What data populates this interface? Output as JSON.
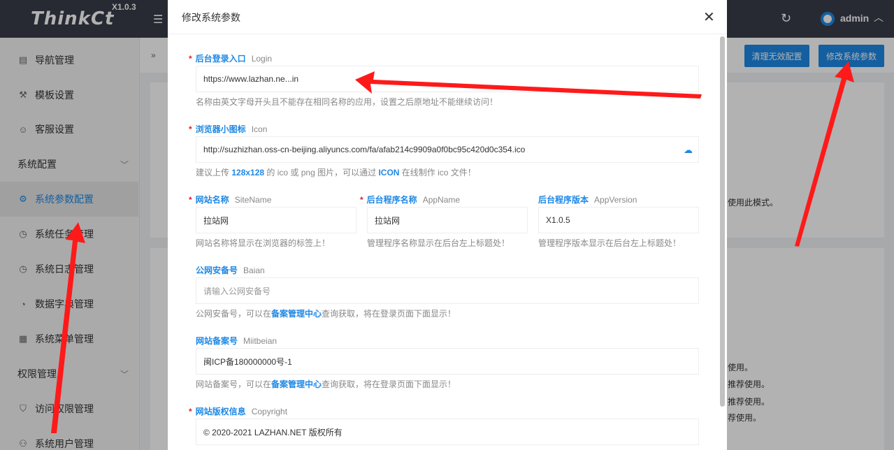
{
  "header": {
    "logo": "ThinkCt",
    "version": "X1.0.3",
    "user": "admin"
  },
  "sidebar": {
    "items": [
      {
        "label": "导航管理",
        "icon": "file-icon"
      },
      {
        "label": "模板设置",
        "icon": "hammer-icon"
      },
      {
        "label": "客服设置",
        "icon": "smile-icon"
      },
      {
        "label": "系统配置",
        "group": true
      },
      {
        "label": "系统参数配置",
        "icon": "gear-icon",
        "active": true
      },
      {
        "label": "系统任务管理",
        "icon": "clock-icon"
      },
      {
        "label": "系统日志管理",
        "icon": "clock-icon"
      },
      {
        "label": "数据字典管理",
        "icon": "dashboard-icon"
      },
      {
        "label": "系统菜单管理",
        "icon": "calendar-icon"
      },
      {
        "label": "权限管理",
        "group": true
      },
      {
        "label": "访问权限管理",
        "icon": "shield-icon"
      },
      {
        "label": "系统用户管理",
        "icon": "user-icon"
      }
    ]
  },
  "toolbar": {
    "clean_label": "清理无效配置",
    "edit_label": "修改系统参数"
  },
  "background": {
    "note1": "使用此模式。",
    "note2": "使用。",
    "note3": "推荐使用。",
    "note4": "推荐使用。",
    "note5": "荐使用。"
  },
  "modal": {
    "title": "修改系统参数",
    "fields": {
      "login": {
        "label": "后台登录入口",
        "label_en": "Login",
        "value": "https://www.lazhan.ne...in",
        "help": "名称由英文字母开头且不能存在相同名称的应用，设置之后原地址不能继续访问！"
      },
      "icon": {
        "label": "浏览器小图标",
        "label_en": "Icon",
        "value": "http://suzhizhan.oss-cn-beijing.aliyuncs.com/fa/afab214c9909a0f0bc95c420d0c354.ico",
        "help_pre": "建议上传 ",
        "help_size": "128x128",
        "help_mid": " 的 ico 或 png 图片，可以通过 ",
        "help_link": "ICON",
        "help_post": " 在线制作 ico 文件！"
      },
      "sitename": {
        "label": "网站名称",
        "label_en": "SiteName",
        "value": "拉站网",
        "help": "网站名称将显示在浏览器的标签上！"
      },
      "appname": {
        "label": "后台程序名称",
        "label_en": "AppName",
        "value": "拉站网",
        "help": "管理程序名称显示在后台左上标题处！"
      },
      "appversion": {
        "label": "后台程序版本",
        "label_en": "AppVersion",
        "value": "X1.0.5",
        "help": "管理程序版本显示在后台左上标题处！"
      },
      "baian": {
        "label": "公网安备号",
        "label_en": "Baian",
        "placeholder": "请输入公网安备号",
        "help_pre": "公网安备号，可以在",
        "help_link": "备案管理中心",
        "help_post": "查询获取，将在登录页面下面显示！"
      },
      "miitbeian": {
        "label": "网站备案号",
        "label_en": "Miitbeian",
        "value": "闽ICP备180000000号-1",
        "help_pre": "网站备案号，可以在",
        "help_link": "备案管理中心",
        "help_post": "查询获取，将在登录页面下面显示！"
      },
      "copyright": {
        "label": "网站版权信息",
        "label_en": "Copyright",
        "value": "© 2020-2021 LAZHAN.NET 版权所有"
      }
    }
  },
  "colors": {
    "accent": "#1e88e5",
    "topbar": "#393d49",
    "required": "#e02020",
    "arrow": "#ff1a1a"
  }
}
